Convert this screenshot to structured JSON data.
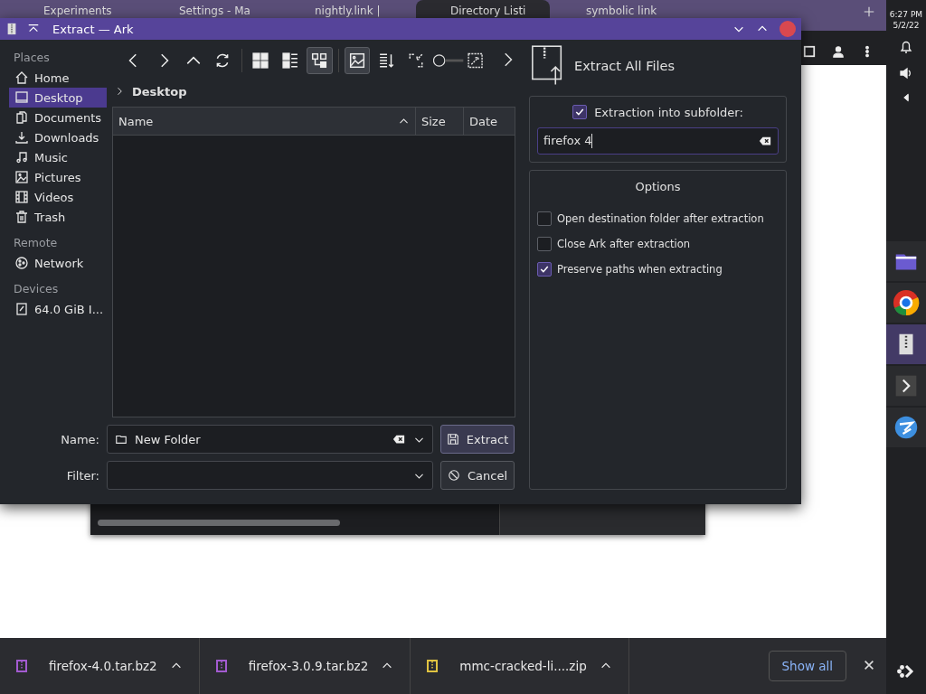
{
  "browser": {
    "tabs": [
      {
        "title": "Experiments",
        "selected": false
      },
      {
        "title": "Settings - Ma",
        "selected": false
      },
      {
        "title": "nightly.link |",
        "selected": false
      },
      {
        "title": "Directory Listi",
        "selected": true
      },
      {
        "title": "symbolic link",
        "selected": false
      }
    ],
    "downloads": [
      {
        "name": "firefox-4.0.tar.bz2",
        "color": "#a35bd0"
      },
      {
        "name": "firefox-3.0.9.tar.bz2",
        "color": "#a35bd0"
      },
      {
        "name": "mmc-cracked-li....zip",
        "color": "#e0c341"
      }
    ],
    "show_all": "Show all"
  },
  "clock": {
    "time": "6:27 PM",
    "date": "5/2/22"
  },
  "dialog": {
    "title": "Extract — Ark",
    "places": [
      {
        "section": "Places",
        "items": [
          {
            "label": "Home",
            "selected": false
          },
          {
            "label": "Desktop",
            "selected": true
          },
          {
            "label": "Documents",
            "selected": false
          },
          {
            "label": "Downloads",
            "selected": false
          },
          {
            "label": "Music",
            "selected": false
          },
          {
            "label": "Pictures",
            "selected": false
          },
          {
            "label": "Videos",
            "selected": false
          },
          {
            "label": "Trash",
            "selected": false
          }
        ]
      },
      {
        "section": "Remote",
        "items": [
          {
            "label": "Network",
            "selected": false
          }
        ]
      },
      {
        "section": "Devices",
        "items": [
          {
            "label": "64.0 GiB I...",
            "selected": false
          }
        ]
      }
    ],
    "views": [
      {
        "selected": false
      },
      {
        "selected": false
      },
      {
        "selected": true
      }
    ],
    "preview": {
      "selected": true
    },
    "breadcrumb": "Desktop",
    "columns": [
      "Name",
      "Size",
      "Date"
    ],
    "name_label": "Name:",
    "name_value": "New Folder",
    "filter_label": "Filter:",
    "buttons": [
      {
        "label": "Extract",
        "kind": "save",
        "selected": true
      },
      {
        "label": "Cancel",
        "kind": "cancel",
        "selected": false
      }
    ],
    "header": "Extract All Files",
    "subfolder": {
      "label": "Extraction into subfolder:",
      "checked": true,
      "value": "firefox 4"
    },
    "options_title": "Options",
    "options": [
      {
        "label": "Open destination folder after extraction",
        "checked": false
      },
      {
        "label": "Close Ark after extraction",
        "checked": false
      },
      {
        "label": "Preserve paths when extracting",
        "checked": true
      }
    ]
  }
}
